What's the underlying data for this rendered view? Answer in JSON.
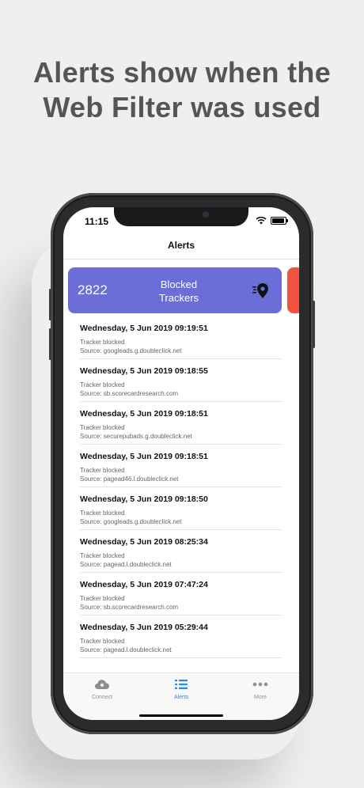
{
  "headline": {
    "line1": "Alerts show when the",
    "line2": "Web Filter was used"
  },
  "status_bar": {
    "time": "11:15"
  },
  "nav": {
    "title": "Alerts"
  },
  "summary_card": {
    "count": "2822",
    "label_line1": "Blocked",
    "label_line2": "Trackers",
    "color": "#6b6ed6",
    "peek_color": "#f0533f"
  },
  "alerts": [
    {
      "title": "Wednesday, 5 Jun 2019 09:19:51",
      "status": "Tracker blocked",
      "source": "Source: googleads.g.doubleclick.net"
    },
    {
      "title": "Wednesday, 5 Jun 2019 09:18:55",
      "status": "Tracker blocked",
      "source": "Source: sb.scorecardresearch.com"
    },
    {
      "title": "Wednesday, 5 Jun 2019 09:18:51",
      "status": "Tracker blocked",
      "source": "Source: securepubads.g.doubleclick.net"
    },
    {
      "title": "Wednesday, 5 Jun 2019 09:18:51",
      "status": "Tracker blocked",
      "source": "Source: pagead46.l.doubleclick.net"
    },
    {
      "title": "Wednesday, 5 Jun 2019 09:18:50",
      "status": "Tracker blocked",
      "source": "Source: googleads.g.doubleclick.net"
    },
    {
      "title": "Wednesday, 5 Jun 2019 08:25:34",
      "status": "Tracker blocked",
      "source": "Source: pagead.l.doubleclick.net"
    },
    {
      "title": "Wednesday, 5 Jun 2019 07:47:24",
      "status": "Tracker blocked",
      "source": "Source: sb.scorecardresearch.com"
    },
    {
      "title": "Wednesday, 5 Jun 2019 05:29:44",
      "status": "Tracker blocked",
      "source": "Source: pagead.l.doubleclick.net"
    }
  ],
  "tabs": [
    {
      "label": "Connect",
      "icon": "cloud-icon",
      "active": false
    },
    {
      "label": "Alerts",
      "icon": "list-icon",
      "active": true
    },
    {
      "label": "More",
      "icon": "ellipsis-icon",
      "active": false
    }
  ],
  "colors": {
    "accent": "#2b89e8",
    "inactive": "#8e8e93"
  }
}
